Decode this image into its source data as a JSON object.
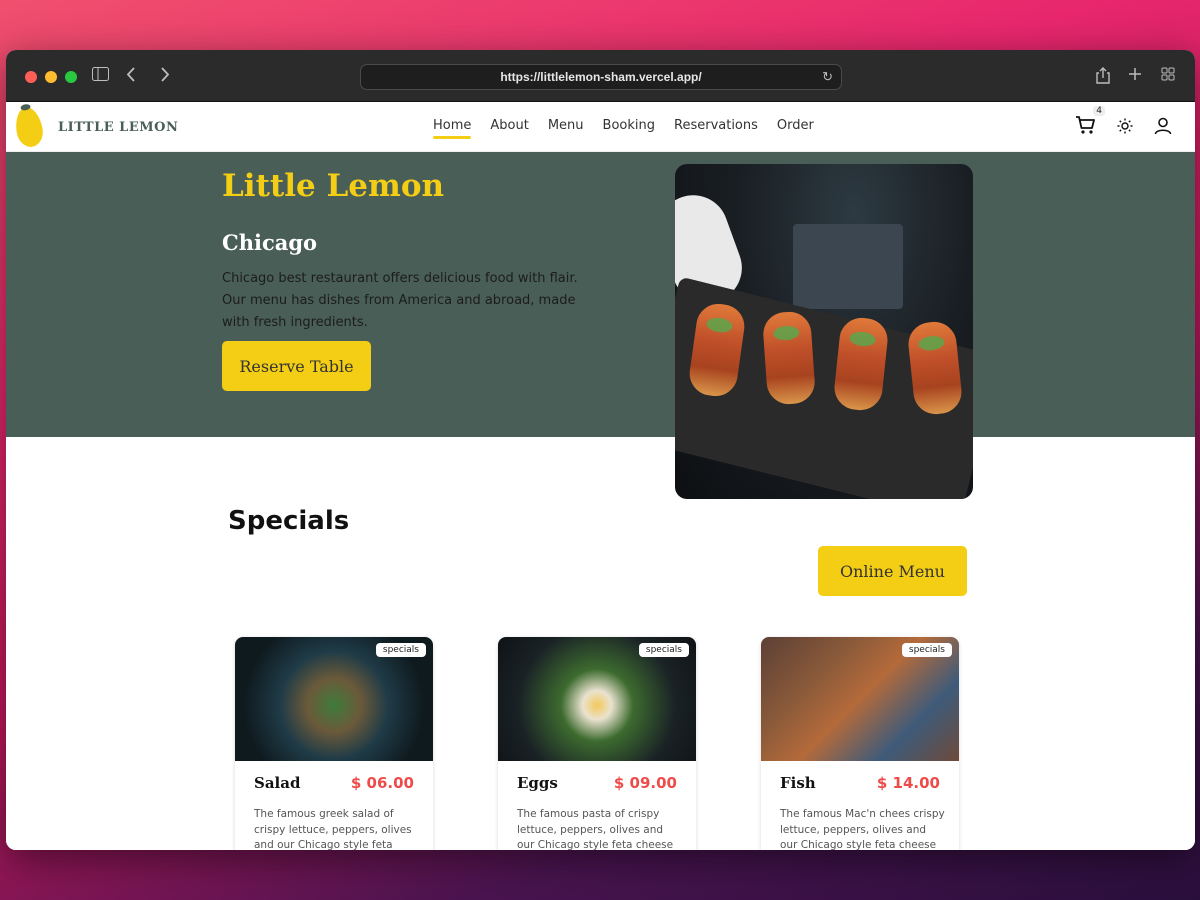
{
  "browser": {
    "url": "https://littlelemon-sham.vercel.app/"
  },
  "nav": {
    "brand": "LITTLE LEMON",
    "links": [
      "Home",
      "About",
      "Menu",
      "Booking",
      "Reservations",
      "Order"
    ],
    "active": "Home",
    "cart_count": "4"
  },
  "hero": {
    "title": "Little Lemon",
    "city": "Chicago",
    "description": "Chicago best restaurant offers delicious food with flair. Our menu has dishes from America and abroad, made with fresh ingredients.",
    "cta": "Reserve Table"
  },
  "specials": {
    "title": "Specials",
    "cta": "Online Menu",
    "tag": "specials",
    "items": [
      {
        "name": "Salad",
        "price": "$ 06.00",
        "description": "The famous greek salad of crispy lettuce, peppers, olives and our Chicago style feta cheese"
      },
      {
        "name": "Eggs",
        "price": "$ 09.00",
        "description": "The famous pasta of crispy lettuce, peppers, olives and our Chicago style feta cheese"
      },
      {
        "name": "Fish",
        "price": "$ 14.00",
        "description": "The famous Mac'n chees crispy lettuce, peppers, olives and our Chicago style feta cheese"
      }
    ]
  },
  "colors": {
    "primary_green": "#495e57",
    "primary_yellow": "#f4ce14",
    "price_red": "#ee4b4b"
  }
}
